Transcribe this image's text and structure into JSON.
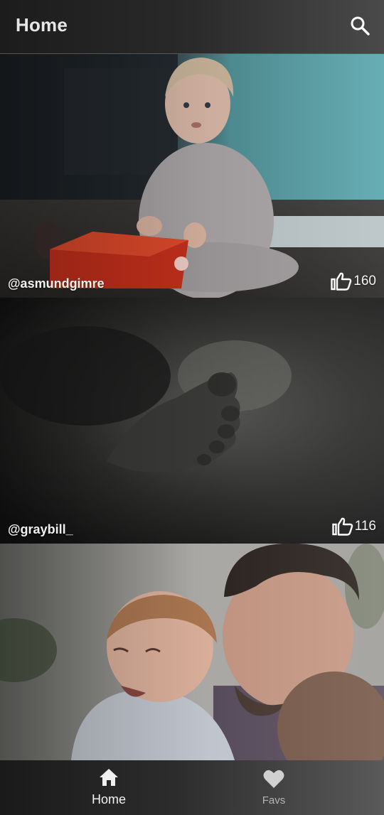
{
  "app": {
    "title": "Home"
  },
  "toolbar": {
    "search_icon": "search-icon"
  },
  "feed": {
    "items": [
      {
        "author": "@asmundgimre",
        "likes": "160",
        "photo": "baby-sitting-with-red-toy"
      },
      {
        "author": "@graybill_",
        "likes": "116",
        "photo": "baby-foot-closeup"
      },
      {
        "author": "",
        "likes": "",
        "photo": "father-holding-smiling-baby"
      }
    ]
  },
  "bottom_nav": {
    "items": [
      {
        "label": "Home",
        "icon": "home-icon",
        "active": true
      },
      {
        "label": "Favs",
        "icon": "heart-icon",
        "active": false
      }
    ]
  },
  "colors": {
    "appbar": "#2a2a2a",
    "active_label": "#f2f2f2",
    "inactive_label": "#b5b5b5"
  }
}
